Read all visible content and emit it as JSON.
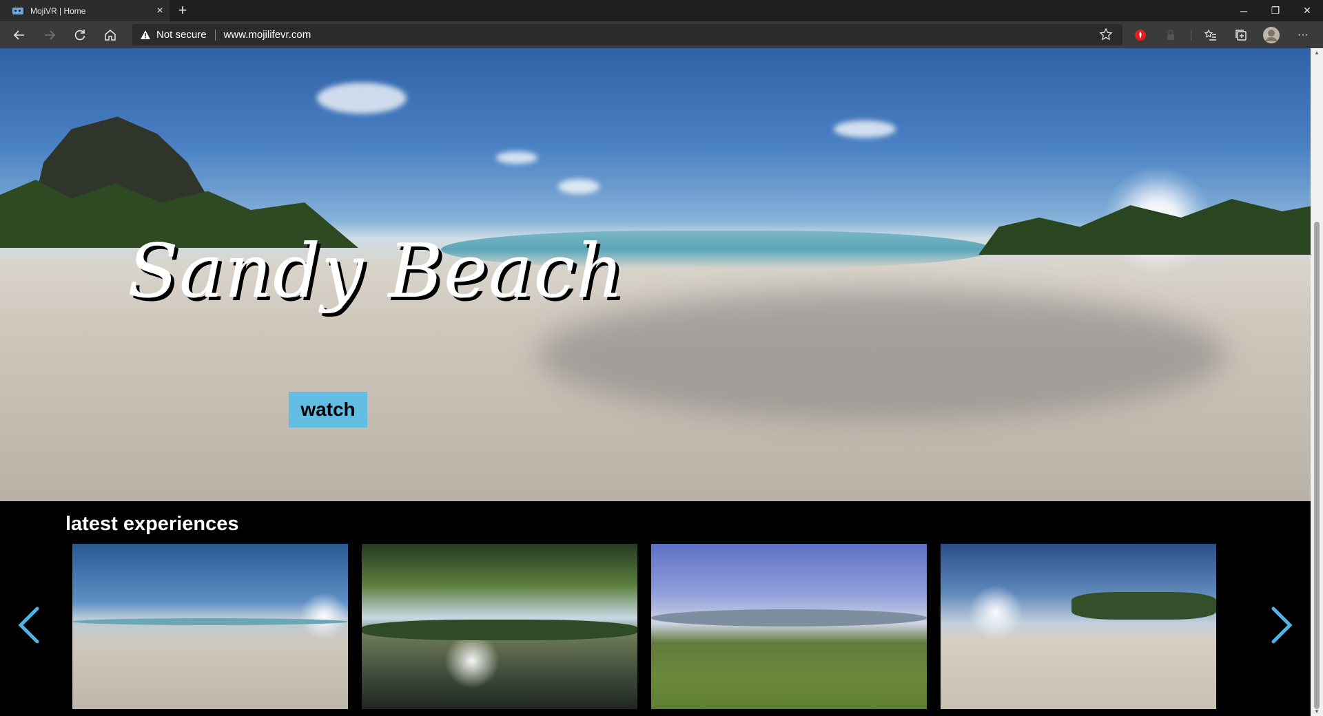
{
  "browser": {
    "tab_title": "MojiVR | Home",
    "tab_close": "×",
    "new_tab": "+",
    "security_text": "Not secure",
    "url": "www.mojilifevr.com",
    "more": "···",
    "minimize": "─",
    "restore": "❐",
    "close": "✕"
  },
  "hero": {
    "title": "Sandy Beach",
    "watch_label": "watch"
  },
  "latest": {
    "heading": "latest experiences",
    "items": [
      {
        "scene": "beach"
      },
      {
        "scene": "forest-river"
      },
      {
        "scene": "meadow"
      },
      {
        "scene": "beach-sunset"
      }
    ]
  },
  "colors": {
    "watch_button": "#62bde2",
    "carousel_arrow": "#4fb3e6",
    "tab_bar": "#1f1f1f",
    "toolbar": "#3b3b3b"
  }
}
